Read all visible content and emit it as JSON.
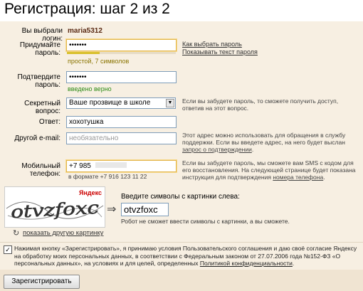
{
  "title": "Регистрация: шаг 2 из 2",
  "login": {
    "label": "Вы выбрали логин:",
    "value": "maria5312"
  },
  "password": {
    "label": "Придумайте пароль:",
    "value": "•••••••",
    "strength_text": "простой, 7 символов",
    "strength_fraction": 0.3,
    "links": [
      "Как выбрать пароль",
      "Показывать текст пароля"
    ]
  },
  "confirm": {
    "label": "Подтвердите пароль:",
    "value": "•••••••",
    "status": "введено верно"
  },
  "secret": {
    "label": "Секретный вопрос:",
    "value": "Ваше прозвище в школе",
    "hint": "Если вы забудете пароль, то сможете получить доступ, ответив на этот вопрос."
  },
  "answer": {
    "label": "Ответ:",
    "value": "хохотушка"
  },
  "email": {
    "label": "Другой e-mail:",
    "placeholder": "необязательно",
    "hint_1": "Этот адрес можно использовать для обращения в службу поддержки. Если вы введете адрес, на него будет выслан ",
    "hint_link": "запрос о подтверждении",
    "hint_2": "."
  },
  "phone": {
    "label": "Мобильный телефон:",
    "value": "+7 985",
    "format": "в формате +7 916 123 11 22",
    "hint_1": "Если вы забудете пароль, мы сможете вам SMS с кодом для его восстановления. На следующей странице будет показана инструкция для подтверждения ",
    "hint_link": "номера телефона",
    "hint_2": "."
  },
  "captcha": {
    "image_text": "otvzfoxc",
    "brand": "Яндекс",
    "prompt": "Введите символы с картинки слева:",
    "value": "otvzfoxc",
    "note": "Робот не сможет ввести символы с картинки, а вы сможете.",
    "refresh_link": "показать другую картинку",
    "arrow": "⇒"
  },
  "agreement": {
    "checked": true,
    "text_1": "Нажимая кнопку «Зарегистрировать», я принимаю условия Пользовательского соглашения и даю своё согласие Яндексу на обработку моих персональных данных, в соответствии с Федеральным законом от 27.07.2006 года №152-ФЗ «О персональных данных», на условиях и для целей, определенных ",
    "link": "Политикой конфиденциальности",
    "text_2": "."
  },
  "submit_label": "Зарегистрировать",
  "colors": {
    "panel": "#f7efe2",
    "footer": "#f0e4d2",
    "ok_green": "#2b8a14",
    "strength": "#d8c02c",
    "active_border": "#e2b54c",
    "yandex_red": "#cc0000"
  }
}
